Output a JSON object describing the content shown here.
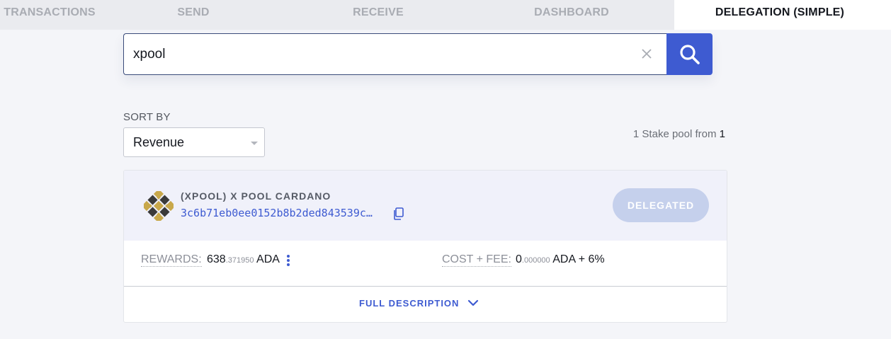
{
  "tabs": [
    {
      "label": "TRANSACTIONS"
    },
    {
      "label": "SEND"
    },
    {
      "label": "RECEIVE"
    },
    {
      "label": "DASHBOARD"
    },
    {
      "label": "DELEGATION (SIMPLE)"
    }
  ],
  "search": {
    "value": "xpool"
  },
  "sort": {
    "label": "SORT BY",
    "selected": "Revenue"
  },
  "pool_count": {
    "prefix": "1 Stake pool from ",
    "total": "1"
  },
  "pool": {
    "name": "(XPOOL) X POOL CARDANO",
    "id": "3c6b71eb0ee0152b8b2ded843539c…",
    "status_button": "DELEGATED",
    "rewards_label": "REWARDS:",
    "rewards_int": "638",
    "rewards_dec": ".371950",
    "rewards_unit": "ADA",
    "cost_label": "COST + FEE:",
    "cost_int": "0",
    "cost_dec": ".000000",
    "cost_suffix": "ADA + 6%",
    "full_description": "FULL DESCRIPTION"
  },
  "colors": {
    "accent": "#3e5bd1",
    "delegated_button": "#c5d0ec",
    "pool_logo_gold": "#c8a84b",
    "pool_logo_dark": "#3a3a3a"
  },
  "icons": {
    "clear": "close-icon",
    "search": "search-icon",
    "copy": "copy-icon",
    "more": "more-vertical-icon",
    "expand": "chevron-down-icon"
  }
}
